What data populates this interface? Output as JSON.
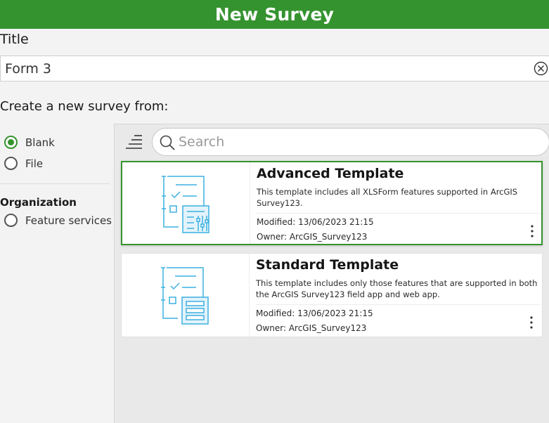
{
  "header": {
    "title": "New Survey"
  },
  "title_field": {
    "label": "Title",
    "value": "Form 3"
  },
  "create_from": {
    "label": "Create a new survey from:",
    "options": [
      {
        "label": "Blank",
        "checked": true
      },
      {
        "label": "File",
        "checked": false
      }
    ],
    "organization": {
      "heading": "Organization",
      "options": [
        {
          "label": "Feature services",
          "checked": false
        }
      ]
    }
  },
  "search": {
    "placeholder": "Search",
    "value": ""
  },
  "templates": [
    {
      "title": "Advanced Template",
      "description": "This template includes all XLSForm features supported in ArcGIS Survey123.",
      "modified": "Modified: 13/06/2023 21:15",
      "owner": "Owner: ArcGIS_Survey123",
      "selected": true,
      "icon": "advanced-template-icon"
    },
    {
      "title": "Standard Template",
      "description": "This template includes only those features that are supported in both the ArcGIS Survey123 field app and web app.",
      "modified": "Modified: 13/06/2023 21:15",
      "owner": "Owner: ArcGIS_Survey123",
      "selected": false,
      "icon": "standard-template-icon"
    }
  ],
  "colors": {
    "accent": "#35932f",
    "icon_blue": "#3bb0e0"
  }
}
